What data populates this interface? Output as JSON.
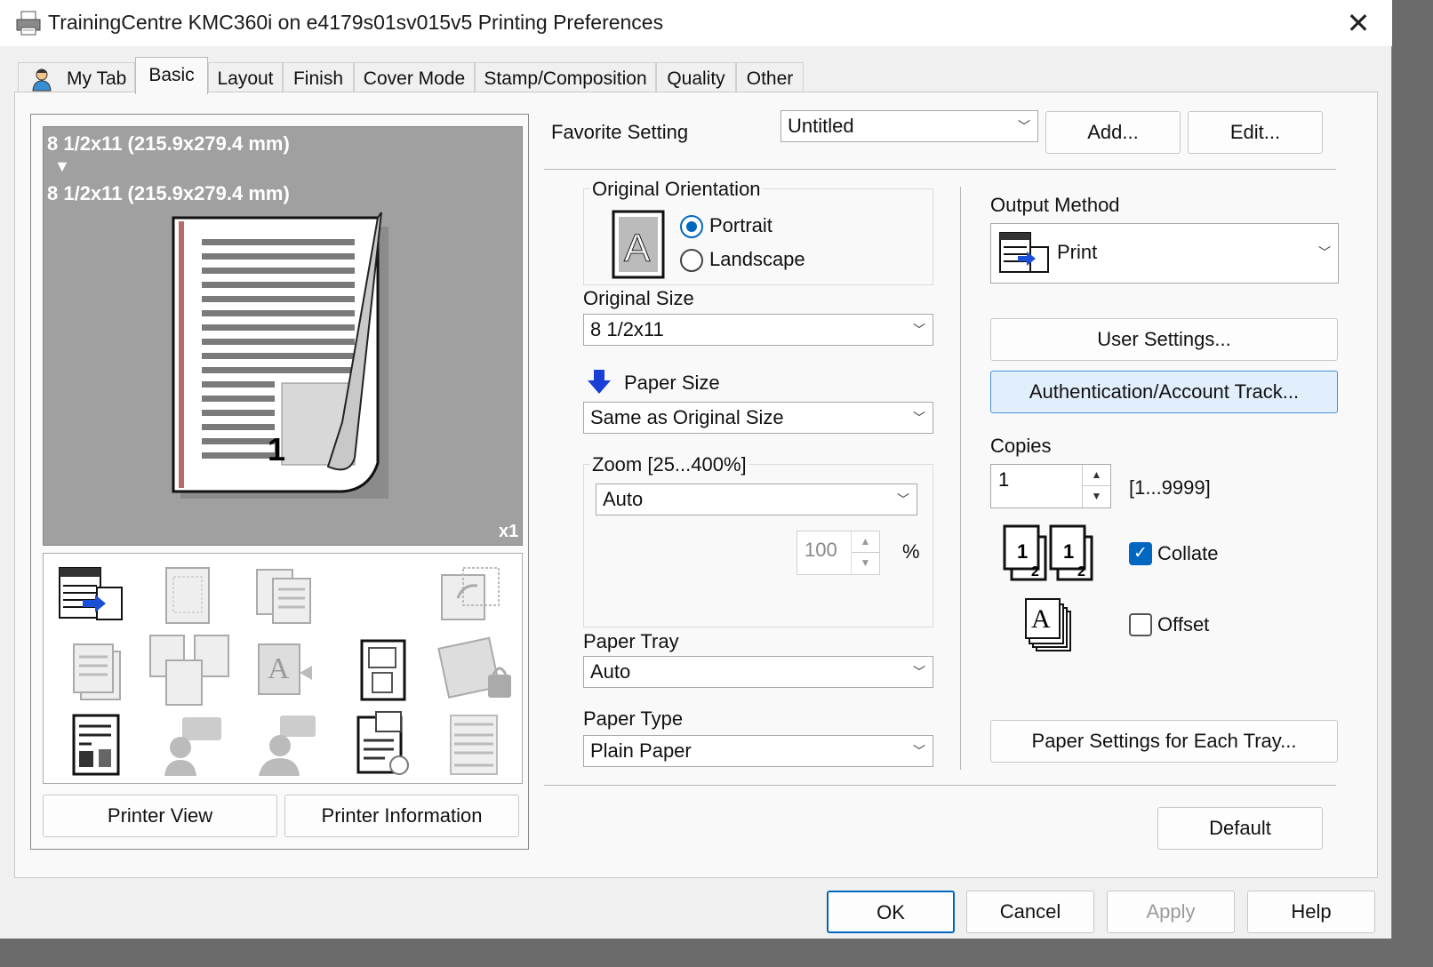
{
  "window": {
    "title": "TrainingCentre KMC360i on e4179s01sv015v5 Printing Preferences",
    "close_glyph": "✕"
  },
  "tabs": [
    {
      "label": "My Tab",
      "icon": "user-icon"
    },
    {
      "label": "Basic",
      "active": true
    },
    {
      "label": "Layout"
    },
    {
      "label": "Finish"
    },
    {
      "label": "Cover Mode"
    },
    {
      "label": "Stamp/Composition"
    },
    {
      "label": "Quality"
    },
    {
      "label": "Other"
    }
  ],
  "preview": {
    "original_size": "8 1/2x11 (215.9x279.4 mm)",
    "arrow": "▼",
    "paper_size": "8 1/2x11 (215.9x279.4 mm)",
    "page_number": "1",
    "copies_badge": "x1",
    "printer_view": "Printer View",
    "printer_information": "Printer Information"
  },
  "favorite": {
    "label": "Favorite Setting",
    "value": "Untitled",
    "add": "Add...",
    "edit": "Edit..."
  },
  "orientation": {
    "label": "Original Orientation",
    "portrait": "Portrait",
    "landscape": "Landscape",
    "selected": "Portrait",
    "glyph": "A"
  },
  "original_size": {
    "label": "Original Size",
    "value": "8 1/2x11"
  },
  "paper_size": {
    "label": "Paper Size",
    "value": "Same as Original Size"
  },
  "zoom": {
    "label": "Zoom [25...400%]",
    "value": "Auto",
    "percent": "100",
    "percent_sign": "%"
  },
  "paper_tray": {
    "label": "Paper Tray",
    "value": "Auto"
  },
  "paper_type": {
    "label": "Paper Type",
    "value": "Plain Paper"
  },
  "output_method": {
    "label": "Output Method",
    "value": "Print"
  },
  "buttons": {
    "user_settings": "User Settings...",
    "authentication": "Authentication/Account Track...",
    "paper_settings": "Paper Settings for Each Tray...",
    "default": "Default",
    "ok": "OK",
    "cancel": "Cancel",
    "apply": "Apply",
    "help": "Help"
  },
  "copies": {
    "label": "Copies",
    "value": "1",
    "range": "[1...9999]"
  },
  "collate": {
    "label": "Collate",
    "checked": true,
    "check_glyph": "✓",
    "page_a": "1",
    "page_b": "2"
  },
  "offset": {
    "label": "Offset",
    "checked": false,
    "glyph": "A"
  },
  "colors": {
    "accent": "#0067c0",
    "preview_bg": "#a0a0a0",
    "tab_body": "#f9f9f9",
    "window_bg": "#f0f0f0"
  }
}
